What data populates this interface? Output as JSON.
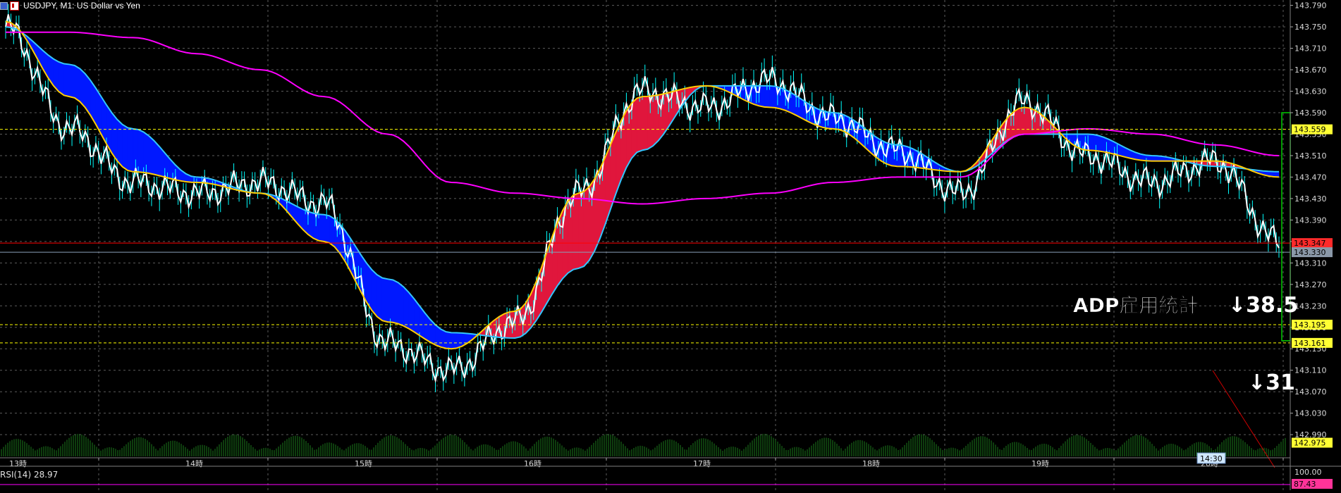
{
  "title": {
    "symbol": "USDJPY, M1:",
    "description": "US Dollar vs Yen"
  },
  "icons": [
    "window-icon",
    "chart-icon"
  ],
  "price_axis": {
    "labels": [
      "143.790",
      "143.750",
      "143.710",
      "143.670",
      "143.630",
      "143.590",
      "143.550",
      "143.510",
      "143.470",
      "143.430",
      "143.390",
      "143.350",
      "143.310",
      "143.270",
      "143.230",
      "143.190",
      "143.150",
      "143.110",
      "143.070",
      "143.030",
      "142.990"
    ],
    "min": 142.96,
    "max": 143.8
  },
  "price_markers": [
    {
      "label": "143.559",
      "price": 143.559,
      "color": "#ffff00",
      "style": "dashed"
    },
    {
      "label": "143.347",
      "price": 143.347,
      "color": "#ff0000",
      "style": "solid"
    },
    {
      "label": "143.330",
      "price": 143.33,
      "color": "#8aa0b8",
      "style": "solid"
    },
    {
      "label": "143.195",
      "price": 143.195,
      "color": "#ffff00",
      "style": "dashed"
    },
    {
      "label": "143.161",
      "price": 143.161,
      "color": "#ffff00",
      "style": "dashed"
    },
    {
      "label": "142.975",
      "price": 142.975,
      "color": "#ffff00",
      "style": "none"
    }
  ],
  "time_axis": {
    "labels": [
      "13時",
      "14時",
      "15時",
      "16時",
      "17時",
      "18時",
      "19時",
      "20時"
    ],
    "badge": "14:30"
  },
  "annotations": {
    "event_label": "ADP雇用統計",
    "change_1": "↓38.5",
    "change_2": "↓31"
  },
  "rsi": {
    "label": "RSI(14) 28.97",
    "axis_label": "100.00",
    "value_label": "87.43"
  },
  "colors": {
    "background": "#000000",
    "grid": "#5c5c5c",
    "candle": "#ffffff",
    "candle_wick": "#00ffff",
    "ma_fast": "#ffcc00",
    "ma_slow": "#33c6ff",
    "ma_long": "#ff00ff",
    "cloud_down": "#0018ff",
    "cloud_up": "#e0163c",
    "volume": "#1c7a1c",
    "event_box": "#00cc00"
  },
  "chart_data": {
    "type": "line",
    "title": "USDJPY, M1: US Dollar vs Yen",
    "xlabel": "",
    "ylabel": "",
    "x": [
      "13時",
      "",
      "14時",
      "",
      "",
      "15時",
      "",
      "",
      "16時",
      "",
      "",
      "17時",
      "",
      "",
      "18時",
      "",
      "",
      "19時",
      "",
      "",
      "20時"
    ],
    "ylim": [
      142.96,
      143.8
    ],
    "series": [
      {
        "name": "close",
        "values": [
          143.75,
          143.56,
          143.46,
          143.44,
          143.46,
          143.42,
          143.16,
          143.11,
          143.2,
          143.44,
          143.63,
          143.6,
          143.65,
          143.58,
          143.52,
          143.44,
          143.61,
          143.51,
          143.46,
          143.5,
          143.35
        ]
      },
      {
        "name": "",
        "values": [
          143.76,
          143.62,
          143.48,
          143.46,
          143.44,
          143.35,
          143.2,
          143.15,
          143.22,
          143.44,
          143.62,
          143.64,
          143.6,
          143.56,
          143.49,
          143.48,
          143.6,
          143.52,
          143.5,
          143.5,
          143.47
        ]
      },
      {
        "name": "",
        "values": [
          143.75,
          143.68,
          143.56,
          143.47,
          143.44,
          143.4,
          143.28,
          143.18,
          143.17,
          143.3,
          143.52,
          143.64,
          143.64,
          143.59,
          143.53,
          143.48,
          143.55,
          143.55,
          143.51,
          143.49,
          143.48
        ]
      },
      {
        "name": "",
        "values": [
          143.74,
          143.74,
          143.73,
          143.7,
          143.67,
          143.62,
          143.55,
          143.46,
          143.44,
          143.43,
          143.42,
          143.43,
          143.44,
          143.46,
          143.47,
          143.47,
          143.55,
          143.56,
          143.55,
          143.53,
          143.51
        ]
      }
    ]
  }
}
